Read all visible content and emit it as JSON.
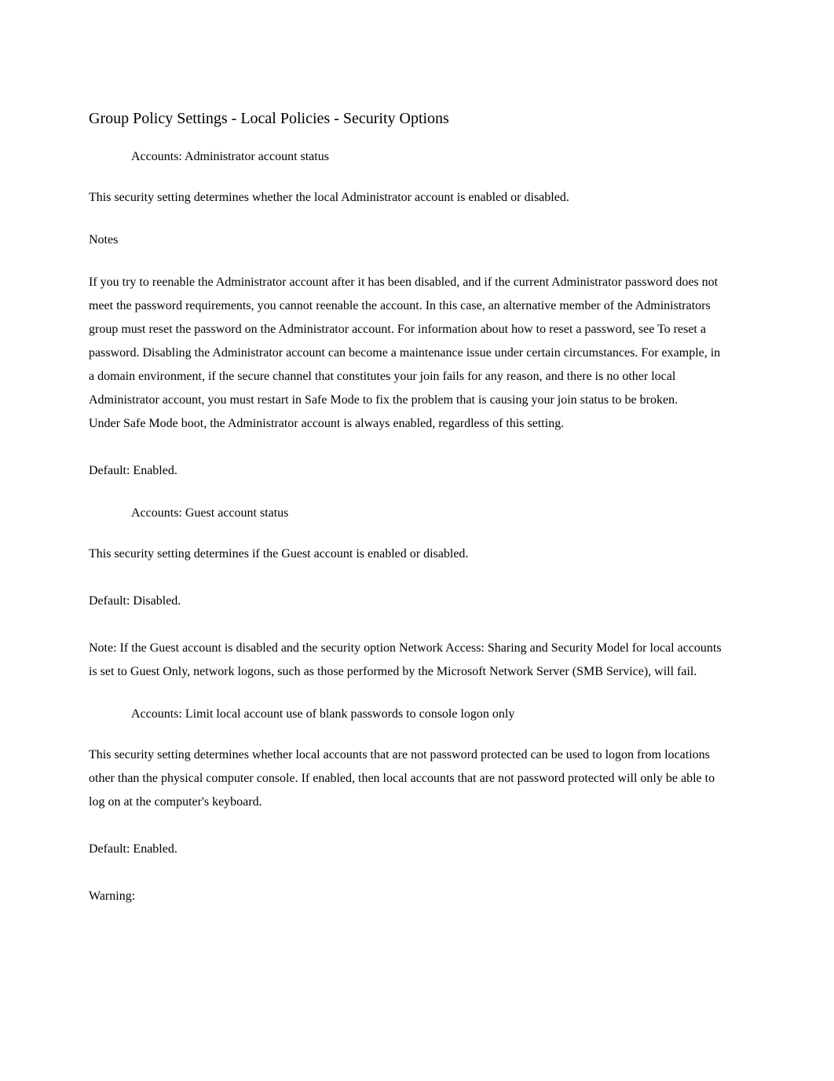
{
  "page_title": "Group Policy Settings - Local Policies - Security Options",
  "bullet_glyph": "",
  "settings": [
    {
      "title": "Accounts: Administrator account status",
      "intro": "This security setting determines whether the local Administrator account is enabled or disabled.",
      "notes_label": "Notes",
      "body1": "If you try to reenable the Administrator account after it has been disabled, and if the current Administrator password does not meet the password requirements, you cannot reenable the account. In this case, an alternative member of the Administrators group must reset the password on the Administrator account. For information about how to reset a password, see To reset a password. Disabling the Administrator account can become a maintenance issue under certain circumstances. For example, in a domain environment, if the secure channel that constitutes your join fails for any reason, and there is no other local Administrator account, you must restart in Safe Mode to fix the problem that is causing your join status to be broken.",
      "body2": "Under Safe Mode boot, the Administrator account is always enabled, regardless of this setting.",
      "default": "Default: Enabled."
    },
    {
      "title": "Accounts: Guest account status",
      "intro": "This security setting determines if the Guest account is enabled or disabled.",
      "default": "Default: Disabled.",
      "note": "Note: If the Guest account is disabled and the security option Network Access: Sharing and Security Model for local accounts is set to Guest Only, network logons, such as those performed by the Microsoft Network Server (SMB Service), will fail."
    },
    {
      "title": "Accounts: Limit local account use of blank passwords to console logon only",
      "intro": "This security setting determines whether local accounts that are not password protected can be used to logon from locations other than the physical computer console. If enabled, then local accounts that are not password protected will only be able to log on at the computer's keyboard.",
      "default": "Default: Enabled.",
      "warning": "Warning:"
    }
  ]
}
